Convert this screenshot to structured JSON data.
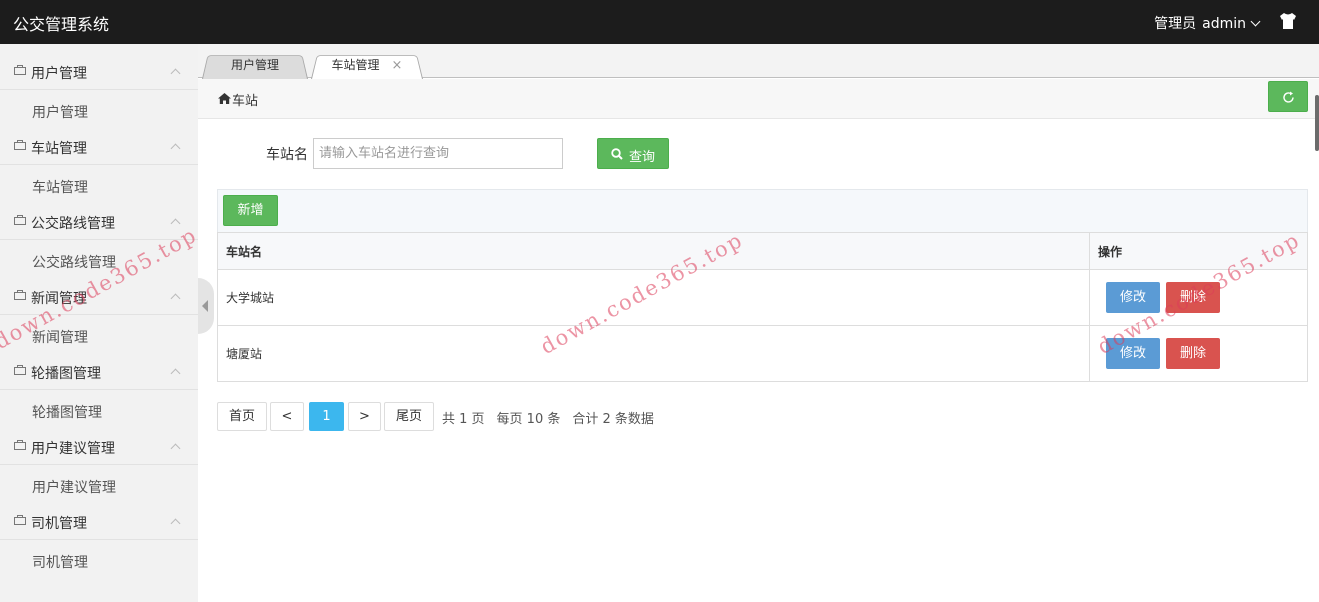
{
  "app": {
    "title": "公交管理系统"
  },
  "header": {
    "role": "管理员",
    "username": "admin",
    "shirt_icon": "tshirt-icon"
  },
  "sidebar": {
    "groups": [
      {
        "label": "用户管理",
        "sub": "用户管理"
      },
      {
        "label": "车站管理",
        "sub": "车站管理"
      },
      {
        "label": "公交路线管理",
        "sub": "公交路线管理"
      },
      {
        "label": "新闻管理",
        "sub": "新闻管理"
      },
      {
        "label": "轮播图管理",
        "sub": "轮播图管理"
      },
      {
        "label": "用户建议管理",
        "sub": "用户建议管理"
      },
      {
        "label": "司机管理",
        "sub": "司机管理"
      }
    ]
  },
  "tabs": [
    {
      "label": "用户管理",
      "active": false
    },
    {
      "label": "车站管理",
      "active": true,
      "close": "×"
    }
  ],
  "breadcrumb": {
    "text": "车站"
  },
  "search": {
    "label": "车站名",
    "placeholder": "请输入车站名进行查询",
    "value": "",
    "button": "查询"
  },
  "toolbar": {
    "add_label": "新增"
  },
  "table": {
    "columns": [
      "车站名",
      "操作"
    ],
    "rows": [
      {
        "name": "大学城站",
        "edit": "修改",
        "delete": "删除"
      },
      {
        "name": "塘厦站",
        "edit": "修改",
        "delete": "删除"
      }
    ]
  },
  "pagination": {
    "first": "首页",
    "prev": "<",
    "current": "1",
    "next": ">",
    "last": "尾页",
    "total_pages": "共 1 页",
    "per_page": "每页 10 条",
    "total": "合计 2 条数据"
  },
  "watermark": {
    "text": "down.code365.top"
  },
  "colors": {
    "topbar": "#1c1c1c",
    "sidebar": "#f2f2f2",
    "success": "#5cb85c",
    "primary": "#5b9bd5",
    "danger": "#d9534f",
    "page_active": "#3cb7ee"
  }
}
